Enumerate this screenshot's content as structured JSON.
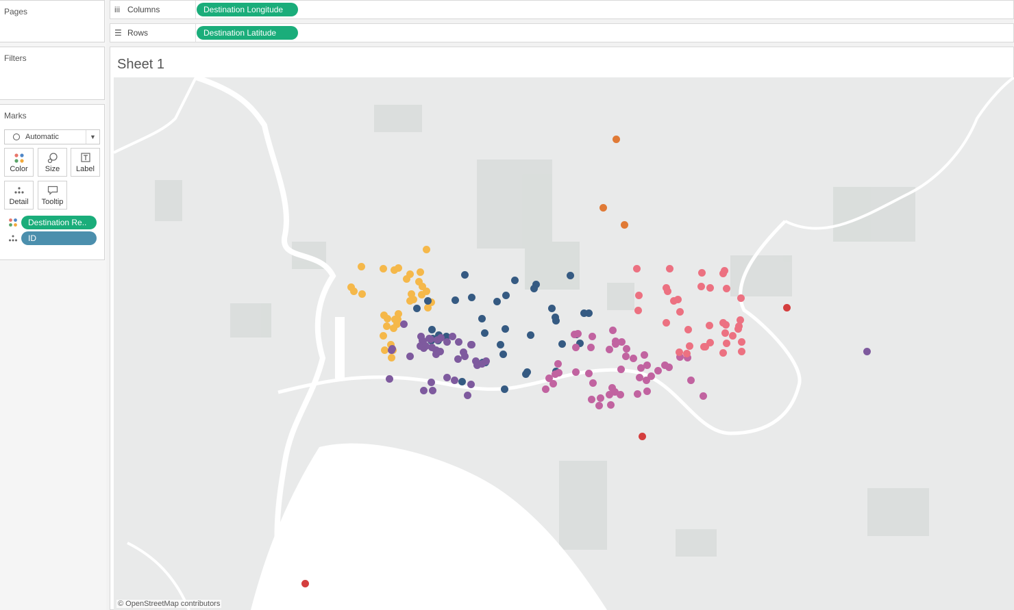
{
  "pages_label": "Pages",
  "filters_label": "Filters",
  "marks": {
    "label": "Marks",
    "type": "Automatic",
    "buttons": [
      "Color",
      "Size",
      "Label",
      "Detail",
      "Tooltip"
    ],
    "fields": [
      {
        "label": "Destination Re..",
        "color": "#1aad7a"
      },
      {
        "label": "ID",
        "color": "#4b8fad"
      }
    ]
  },
  "shelves": {
    "columns_label": "Columns",
    "columns_pill": "Destination Longitude",
    "rows_label": "Rows",
    "rows_pill": "Destination Latitude"
  },
  "sheet_title": "Sheet 1",
  "map_credit": "© OpenStreetMap contributors",
  "region_colors": {
    "orange": "#f5b84a",
    "navy": "#355a82",
    "purple": "#7e5a9e",
    "magenta": "#c163a0",
    "pink": "#ec7181",
    "darkorange": "#e07a36",
    "red": "#d43e3e"
  }
}
